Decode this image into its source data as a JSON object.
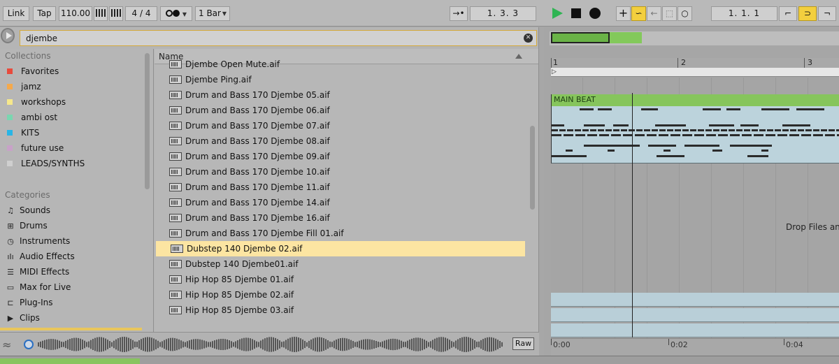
{
  "transport": {
    "link": "Link",
    "tap": "Tap",
    "tempo": "110.00",
    "time_signature": "4 / 4",
    "quantize": "1 Bar",
    "arrangement_position": "1.   3.   3",
    "loop_start": "1.   1.   1",
    "colors": {
      "play": "#2fb453",
      "highlight": "#f3cf3e"
    }
  },
  "browser": {
    "search_value": "djembe",
    "collections_title": "Collections",
    "collections": [
      {
        "label": "Favorites",
        "color": "#e84a3c"
      },
      {
        "label": "jamz",
        "color": "#f5a94b"
      },
      {
        "label": "workshops",
        "color": "#f6e88b"
      },
      {
        "label": "ambi ost",
        "color": "#7ad6b0"
      },
      {
        "label": "KITS",
        "color": "#28b5e6"
      },
      {
        "label": "future use",
        "color": "#c8a2c8"
      },
      {
        "label": "LEADS/SYNTHS",
        "color": "#cfcfcf"
      }
    ],
    "categories_title": "Categories",
    "categories": [
      {
        "label": "Sounds",
        "icon": "music-note-icon"
      },
      {
        "label": "Drums",
        "icon": "drum-grid-icon"
      },
      {
        "label": "Instruments",
        "icon": "clock-dial-icon"
      },
      {
        "label": "Audio Effects",
        "icon": "audio-wave-icon"
      },
      {
        "label": "MIDI Effects",
        "icon": "midi-bars-icon"
      },
      {
        "label": "Max for Live",
        "icon": "max-device-icon"
      },
      {
        "label": "Plug-Ins",
        "icon": "plug-icon"
      },
      {
        "label": "Clips",
        "icon": "clip-play-icon"
      }
    ],
    "column_name": "Name",
    "files": [
      "Djembe Open Mute.aif",
      "Djembe Ping.aif",
      "Drum and Bass 170 Djembe 05.aif",
      "Drum and Bass 170 Djembe 06.aif",
      "Drum and Bass 170 Djembe 07.aif",
      "Drum and Bass 170 Djembe 08.aif",
      "Drum and Bass 170 Djembe 09.aif",
      "Drum and Bass 170 Djembe 10.aif",
      "Drum and Bass 170 Djembe 11.aif",
      "Drum and Bass 170 Djembe 14.aif",
      "Drum and Bass 170 Djembe 16.aif",
      "Drum and Bass 170 Djembe Fill 01.aif",
      "Dubstep 140 Djembe 02.aif",
      "Dubstep 140 Djembe01.aif",
      "Hip Hop 85 Djembe 01.aif",
      "Hip Hop 85 Djembe 02.aif",
      "Hip Hop 85 Djembe 03.aif"
    ],
    "selected_file_index": 12,
    "raw_label": "Raw"
  },
  "arrangement": {
    "bar_numbers": [
      "1",
      "2",
      "3"
    ],
    "clip_name": "MAIN BEAT",
    "drop_hint": "Drop Files and",
    "time_labels": [
      "0:00",
      "0:02",
      "0:04"
    ],
    "clip_color": "#86c55c"
  }
}
